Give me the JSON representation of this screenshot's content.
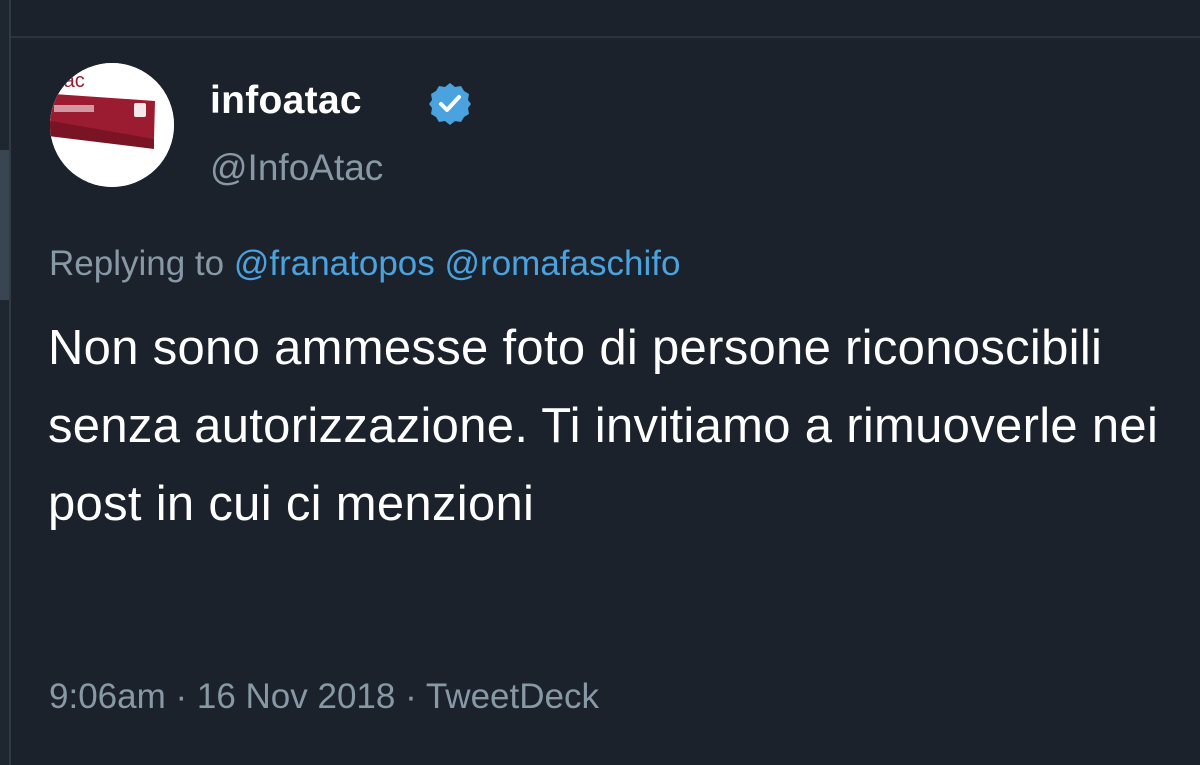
{
  "tweet": {
    "author": {
      "name": "infoatac",
      "handle": "@InfoAtac",
      "verified": true,
      "avatar_icon": "atac-roma-logo",
      "avatar_text": "atac"
    },
    "reply": {
      "prefix": "Replying to",
      "mentions": [
        "@franatopos",
        "@romafaschifo"
      ]
    },
    "text": "Non sono ammesse foto di persone riconoscibili senza autorizzazione. Ti invitiamo a rimuoverle nei post in cui ci menzioni",
    "meta": {
      "time": "9:06am",
      "separator": "·",
      "date": "16 Nov 2018",
      "source": "TweetDeck"
    }
  },
  "colors": {
    "background": "#1b222c",
    "text_primary": "#ffffff",
    "text_secondary": "#8899a6",
    "link": "#4aa3df",
    "verified_badge": "#4aa3df",
    "brand_red": "#9b1b30"
  }
}
